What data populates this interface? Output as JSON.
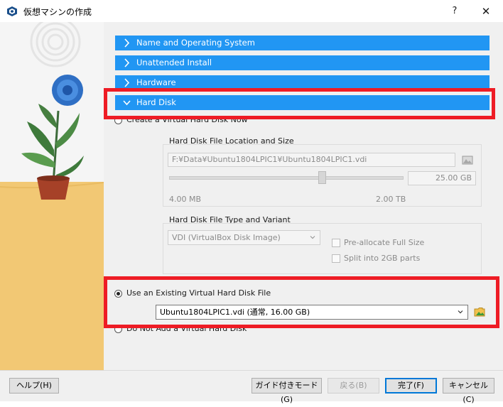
{
  "window": {
    "title": "仮想マシンの作成",
    "help_glyph": "?",
    "close_glyph": "✕"
  },
  "sections": [
    {
      "label": "Name and Operating System",
      "state": "collapsed"
    },
    {
      "label": "Unattended Install",
      "state": "collapsed"
    },
    {
      "label": "Hardware",
      "state": "collapsed"
    },
    {
      "label": "Hard Disk",
      "state": "expanded"
    }
  ],
  "hard_disk": {
    "create_option": "Create a Virtual Hard Disk Now",
    "location_group_title": "Hard Disk File Location and Size",
    "file_path": "F:¥Data¥Ubuntu1804LPIC1¥Ubuntu1804LPIC1.vdi",
    "size_value": "25.00 GB",
    "size_min": "4.00 MB",
    "size_max": "2.00 TB",
    "type_group_title": "Hard Disk File Type and Variant",
    "type_value": "VDI (VirtualBox Disk Image)",
    "preallocate_label": "Pre-allocate Full Size",
    "split_label": "Split into 2GB parts",
    "existing_option": "Use an Existing Virtual Hard Disk File",
    "existing_file": "Ubuntu1804LPIC1.vdi (通常, 16.00 GB)",
    "no_disk_option": "Do Not Add a Virtual Hard Disk",
    "selected_option": "existing"
  },
  "buttons": {
    "help": "ヘルプ(H)",
    "guided": "ガイド付きモード(G)",
    "back": "戻る(B)",
    "finish": "完了(F)",
    "cancel": "キャンセル(C)"
  },
  "colors": {
    "section_bg": "#2196f3",
    "highlight": "#ee1c25"
  }
}
